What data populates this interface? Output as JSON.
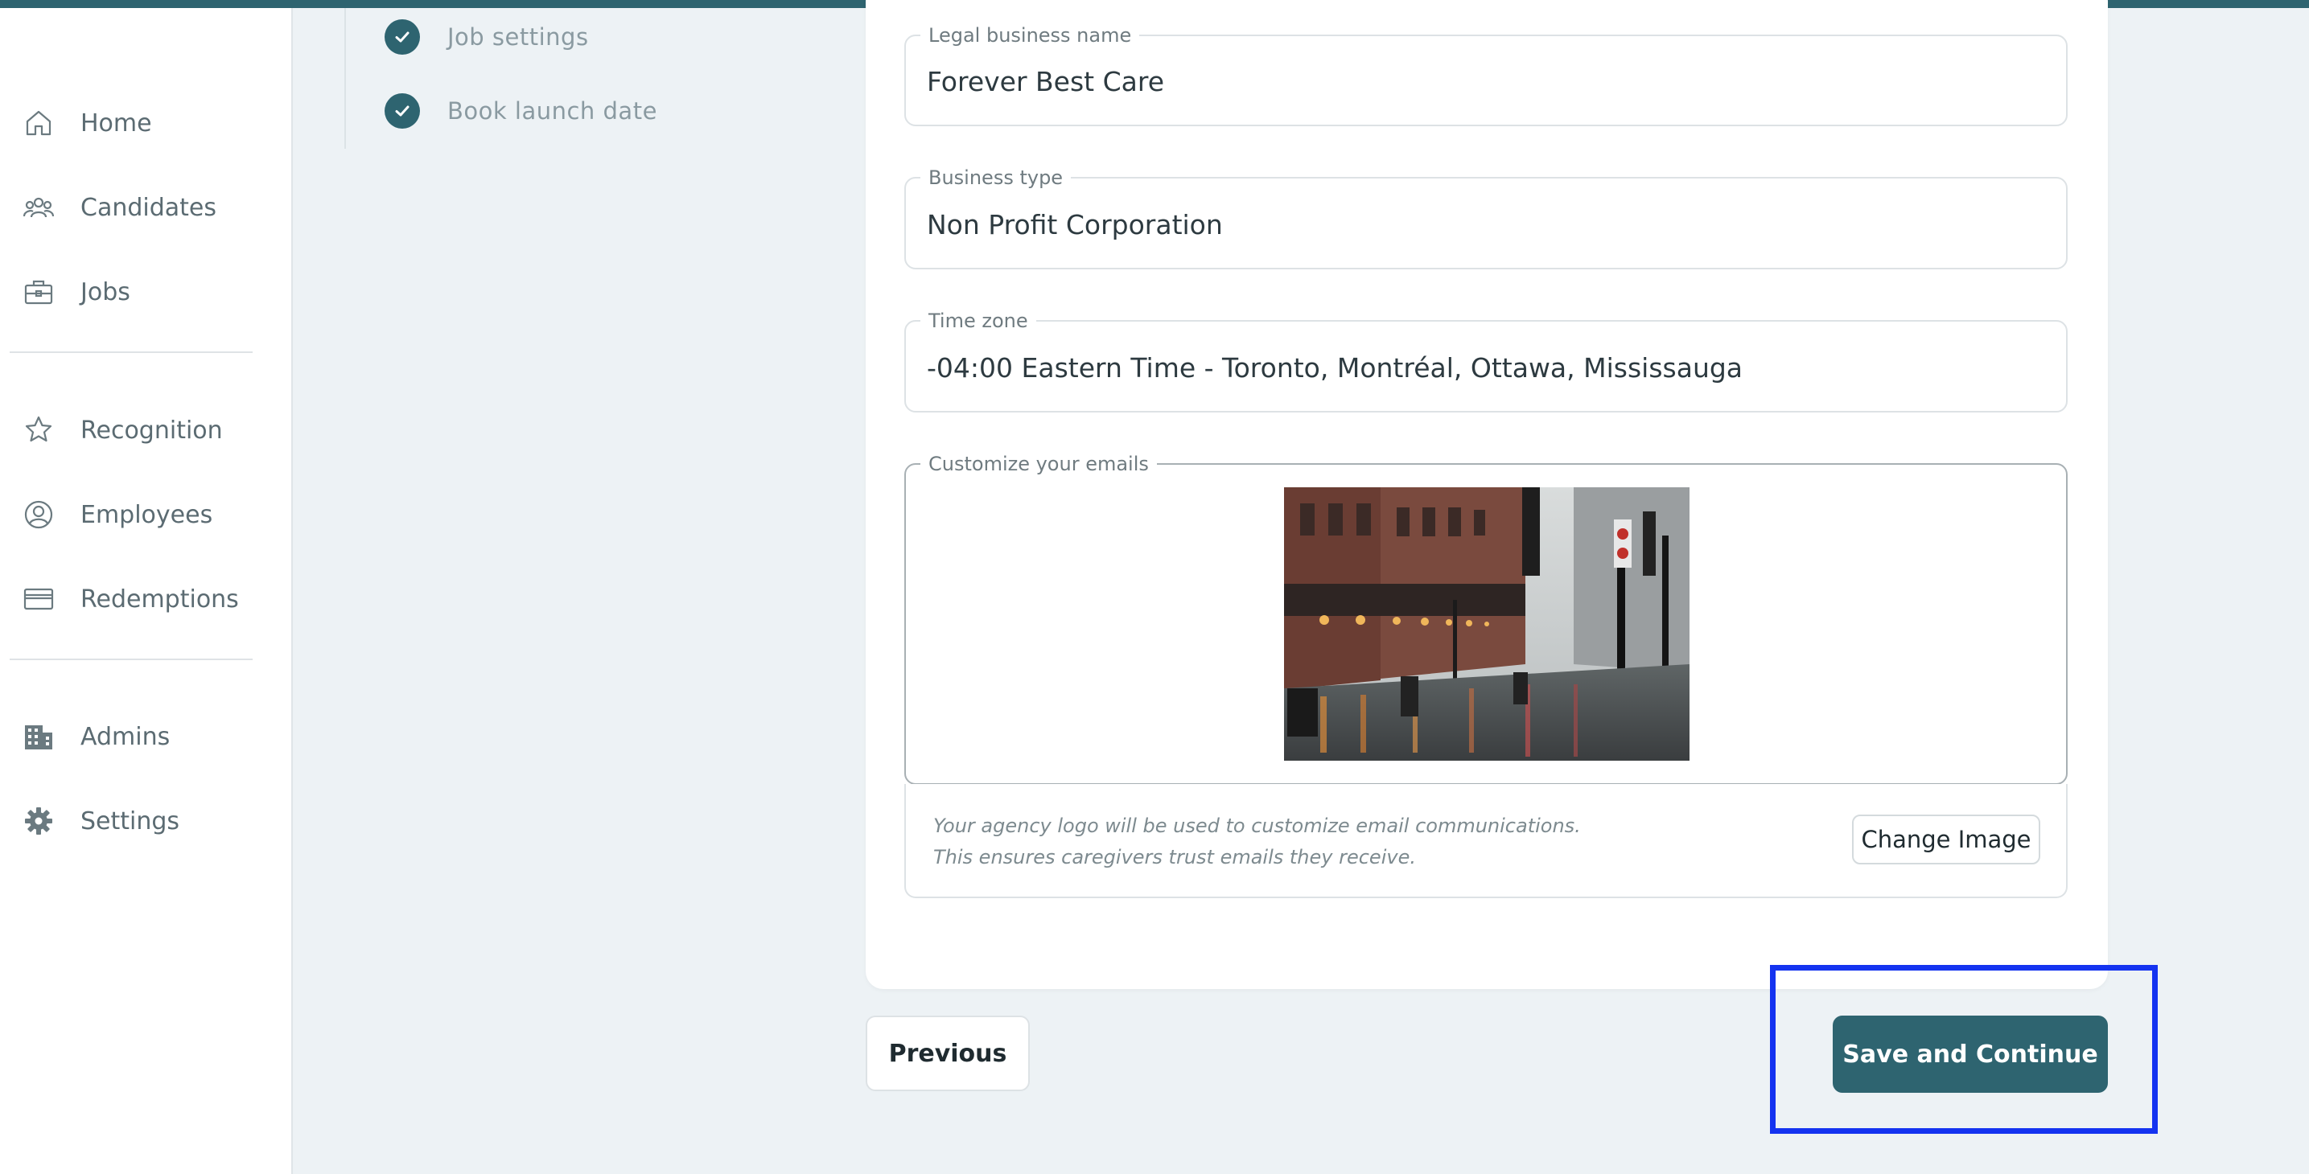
{
  "sidebar": {
    "items": [
      {
        "label": "Home",
        "icon": "home-icon"
      },
      {
        "label": "Candidates",
        "icon": "people-icon"
      },
      {
        "label": "Jobs",
        "icon": "briefcase-icon"
      },
      {
        "label": "Recognition",
        "icon": "star-badge-icon"
      },
      {
        "label": "Employees",
        "icon": "user-circle-icon"
      },
      {
        "label": "Redemptions",
        "icon": "credit-card-icon"
      },
      {
        "label": "Admins",
        "icon": "building-icon"
      },
      {
        "label": "Settings",
        "icon": "gear-icon"
      }
    ]
  },
  "steps": [
    {
      "label": "Job settings",
      "status": "complete"
    },
    {
      "label": "Book launch date",
      "status": "complete"
    }
  ],
  "form": {
    "legal_name": {
      "label": "Legal business name",
      "value": "Forever Best Care"
    },
    "business_type": {
      "label": "Business type",
      "value": "Non Profit Corporation"
    },
    "time_zone": {
      "label": "Time zone",
      "value": "-04:00 Eastern Time - Toronto, Montréal, Ottawa, Mississauga"
    },
    "emails": {
      "label": "Customize your emails",
      "note_line1": "Your agency logo will be used to customize email communications.",
      "note_line2": "This ensures caregivers trust emails they receive.",
      "change_image_label": "Change Image"
    }
  },
  "actions": {
    "previous_label": "Previous",
    "save_label": "Save and Continue"
  },
  "colors": {
    "accent": "#2e6470",
    "highlight": "#1433f0",
    "background": "#edf2f5"
  }
}
